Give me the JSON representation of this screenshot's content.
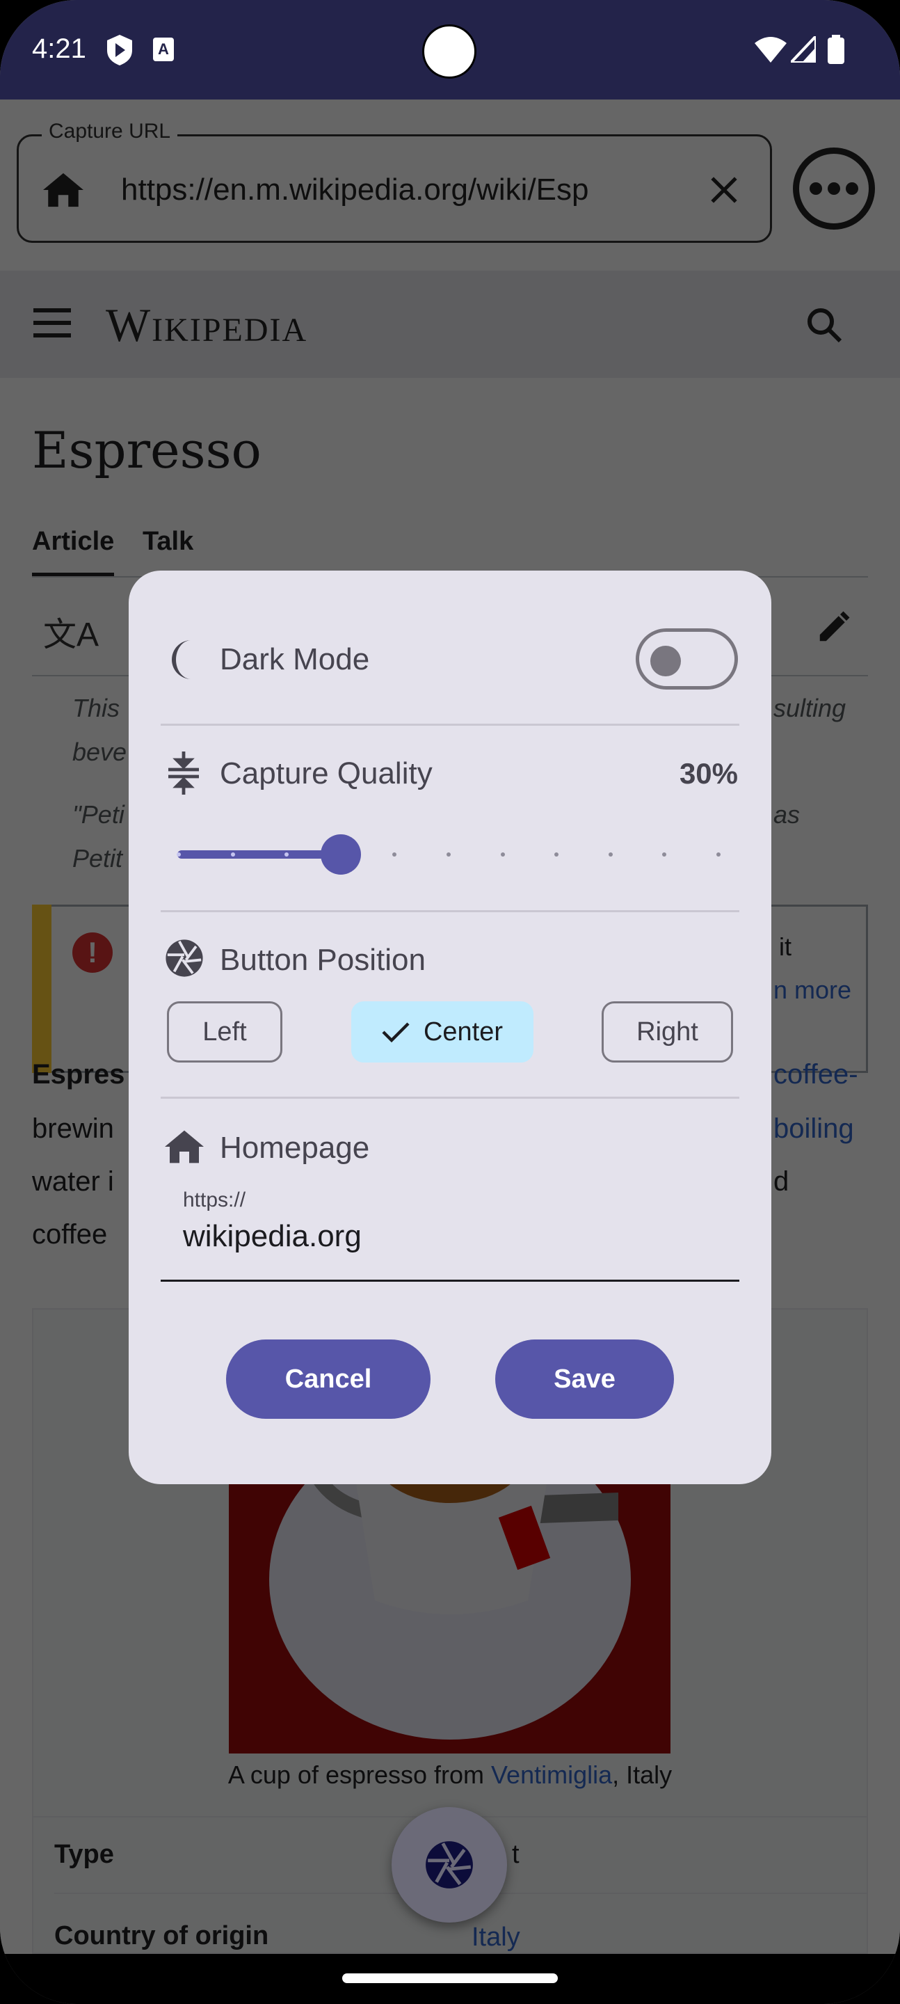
{
  "status_bar": {
    "time": "4:21",
    "icons": [
      "shield-play-icon",
      "text-a-icon",
      "wifi-icon",
      "signal-icon",
      "battery-icon"
    ],
    "color": "#23234a"
  },
  "url_bar": {
    "label": "Capture URL",
    "value": "https://en.m.wikipedia.org/wiki/Esp",
    "home_icon": "home-icon",
    "clear_icon": "close-icon",
    "more_icon": "more-horizontal-icon"
  },
  "wiki": {
    "logo": "Wikipedia",
    "menu_icon": "menu-icon",
    "search_icon": "search-icon",
    "title": "Espresso",
    "tabs": [
      "Article",
      "Talk"
    ],
    "fragments": {
      "hat1a": "This",
      "hat1b": "sulting",
      "hat2": "beve",
      "hat3a": "\"Peti",
      "hat3b": "as",
      "hat4": "Petit",
      "warn1": "it",
      "warn2": "n more",
      "p1a": "Espres",
      "p1b": "coffee-",
      "p2a": "brewin",
      "p2b": "boiling",
      "p3a": "water i",
      "p3b": "d",
      "p4a": "coffee"
    },
    "caption_pre": "A cup of espresso from ",
    "caption_link": "Ventimiglia",
    "caption_post": ", Italy",
    "infobox": [
      {
        "label": "Type",
        "value": "t"
      },
      {
        "label": "Country of origin",
        "value": "Italy"
      }
    ]
  },
  "dialog": {
    "dark_mode": {
      "label": "Dark Mode",
      "icon": "moon-icon",
      "enabled": false
    },
    "capture_quality": {
      "label": "Capture Quality",
      "icon": "compress-icon",
      "value_text": "30%",
      "value": 30,
      "min": 0,
      "max": 100,
      "step": 10
    },
    "button_position": {
      "label": "Button Position",
      "icon": "camera-shutter-icon",
      "options": [
        "Left",
        "Center",
        "Right"
      ],
      "selected": "Center"
    },
    "homepage": {
      "label": "Homepage",
      "icon": "home-icon",
      "prefix": "https://",
      "value": "wikipedia.org"
    },
    "cancel": "Cancel",
    "save": "Save"
  },
  "colors": {
    "primary": "#5756a9",
    "dialog_bg": "#e4e2ec",
    "selected_chip": "#c0ebfe"
  },
  "fab": {
    "icon": "camera-shutter-icon"
  }
}
